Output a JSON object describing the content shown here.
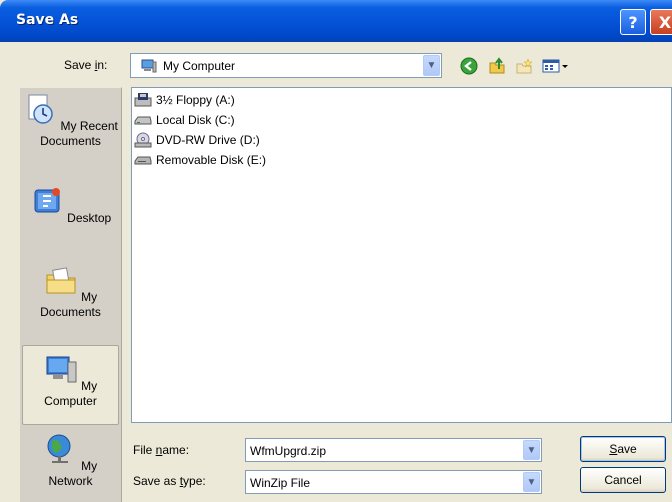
{
  "window": {
    "title": "Save As",
    "help_label": "?",
    "close_label": "X"
  },
  "toolbar": {
    "save_in_label_pre": "Save ",
    "save_in_label_key": "i",
    "save_in_label_post": "n:",
    "save_in_value": "My Computer",
    "icons": [
      "back-icon",
      "up-folder-icon",
      "new-folder-icon",
      "views-menu-icon"
    ]
  },
  "places": [
    {
      "label": "My Recent Documents",
      "icon": "recent-documents-icon"
    },
    {
      "label": "Desktop",
      "icon": "desktop-icon"
    },
    {
      "label": "My Documents",
      "icon": "my-documents-icon"
    },
    {
      "label": "My Computer",
      "icon": "my-computer-icon",
      "selected": true
    },
    {
      "label": "My Network",
      "icon": "my-network-icon"
    }
  ],
  "files": [
    {
      "label": "3½ Floppy (A:)",
      "icon": "floppy-drive-icon"
    },
    {
      "label": "Local Disk (C:)",
      "icon": "hard-disk-icon"
    },
    {
      "label": "DVD-RW Drive (D:)",
      "icon": "dvd-drive-icon"
    },
    {
      "label": "Removable Disk (E:)",
      "icon": "removable-disk-icon"
    }
  ],
  "form": {
    "file_name_pre": "File ",
    "file_name_key": "n",
    "file_name_post": "ame:",
    "file_name_value": "WfmUpgrd.zip",
    "save_type_pre": "Save as ",
    "save_type_key": "t",
    "save_type_post": "ype:",
    "save_type_value": "WinZip File"
  },
  "buttons": {
    "save_key": "S",
    "save_rest": "ave",
    "cancel": "Cancel"
  }
}
